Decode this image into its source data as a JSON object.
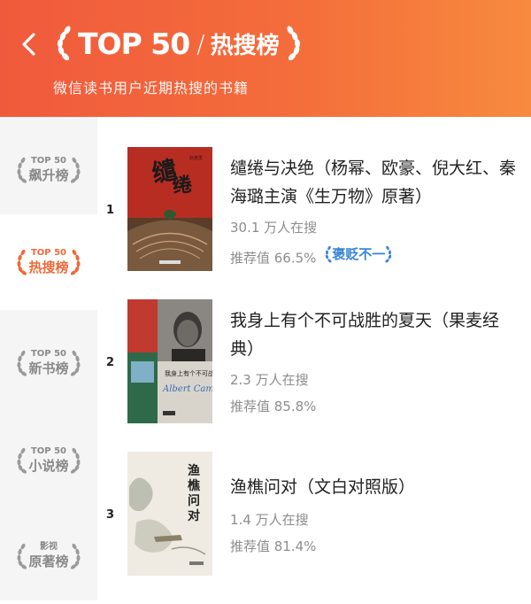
{
  "header": {
    "top50_logo": "TOP 50",
    "slash": "/",
    "title": "热搜榜",
    "subtitle": "微信读书用户近期热搜的书籍"
  },
  "sidebar": {
    "tabs": [
      {
        "small": "TOP 50",
        "big": "飙升榜",
        "active": false
      },
      {
        "small": "TOP 50",
        "big": "热搜榜",
        "active": true
      },
      {
        "small": "TOP 50",
        "big": "新书榜",
        "active": false
      },
      {
        "small": "TOP 50",
        "big": "小说榜",
        "active": false
      },
      {
        "small": "影视",
        "big": "原著榜",
        "active": false
      }
    ]
  },
  "books": [
    {
      "rank": "1",
      "title": "缱绻与决绝（杨幂、欧豪、倪大红、秦海璐主演《生万物》原著）",
      "searchers": "30.1 万人在搜",
      "rating": "推荐值 66.5%",
      "badge": "褒贬不一",
      "cover_text": "赵德发"
    },
    {
      "rank": "2",
      "title": "我身上有个不可战胜的夏天（果麦经典）",
      "searchers": "2.3 万人在搜",
      "rating": "推荐值 85.8%",
      "cover_text": "我身上有个不可战胜的夏天",
      "cover_signature": "Albert Camus"
    },
    {
      "rank": "3",
      "title": "渔樵问对（文白对照版）",
      "searchers": "1.4 万人在搜",
      "rating": "推荐值 81.4%",
      "cover_text": "渔樵问对"
    }
  ],
  "colors": {
    "header_gradient_start": "#f05a3c",
    "header_gradient_end": "#f78a3e",
    "active_tab": "#ef6a3a",
    "badge": "#3a86d6"
  }
}
